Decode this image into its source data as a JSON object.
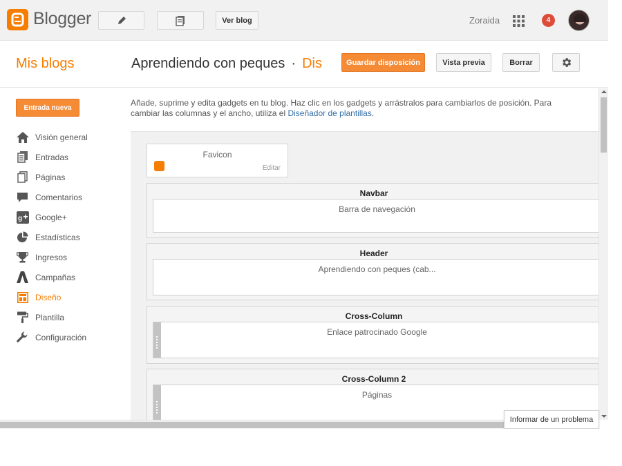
{
  "topbar": {
    "brand": "Blogger",
    "view_blog_label": "Ver blog",
    "user_name": "Zoraida",
    "notification_count": "4",
    "brand_color": "#f57d00"
  },
  "titlebar": {
    "my_blogs": "Mis blogs",
    "blog_name": "Aprendiendo con peques",
    "separator": "·",
    "section": "Dis",
    "save_layout_label": "Guardar disposición",
    "preview_label": "Vista previa",
    "delete_label": "Borrar"
  },
  "sidebar": {
    "new_post_label": "Entrada nueva",
    "items": [
      {
        "label": "Visión general",
        "icon": "home-icon"
      },
      {
        "label": "Entradas",
        "icon": "posts-icon"
      },
      {
        "label": "Páginas",
        "icon": "pages-icon"
      },
      {
        "label": "Comentarios",
        "icon": "comment-icon"
      },
      {
        "label": "Google+",
        "icon": "google-plus-icon"
      },
      {
        "label": "Estadísticas",
        "icon": "pie-chart-icon"
      },
      {
        "label": "Ingresos",
        "icon": "trophy-icon"
      },
      {
        "label": "Campañas",
        "icon": "adwords-icon"
      },
      {
        "label": "Diseño",
        "icon": "layout-icon",
        "active": true
      },
      {
        "label": "Plantilla",
        "icon": "paint-roller-icon"
      },
      {
        "label": "Configuración",
        "icon": "wrench-icon"
      }
    ]
  },
  "main": {
    "intro_text": "Añade, suprime y edita gadgets en tu blog. Haz clic en los gadgets y arrástralos para cambiarlos de posición. Para cambiar las columnas y el ancho, utiliza el",
    "intro_link": "Diseñador de plantillas",
    "intro_end": ".",
    "favicon": {
      "name": "Favicon",
      "edit_label": "Editar"
    },
    "sections": [
      {
        "name": "Navbar",
        "gadget": "Barra de navegación",
        "draggable": false
      },
      {
        "name": "Header",
        "gadget": "Aprendiendo con peques (cab...",
        "draggable": false
      },
      {
        "name": "Cross-Column",
        "gadget": "Enlace patrocinado Google",
        "draggable": true
      },
      {
        "name": "Cross-Column 2",
        "gadget": "Páginas",
        "draggable": true
      }
    ]
  },
  "report_problem_label": "Informar de un problema"
}
